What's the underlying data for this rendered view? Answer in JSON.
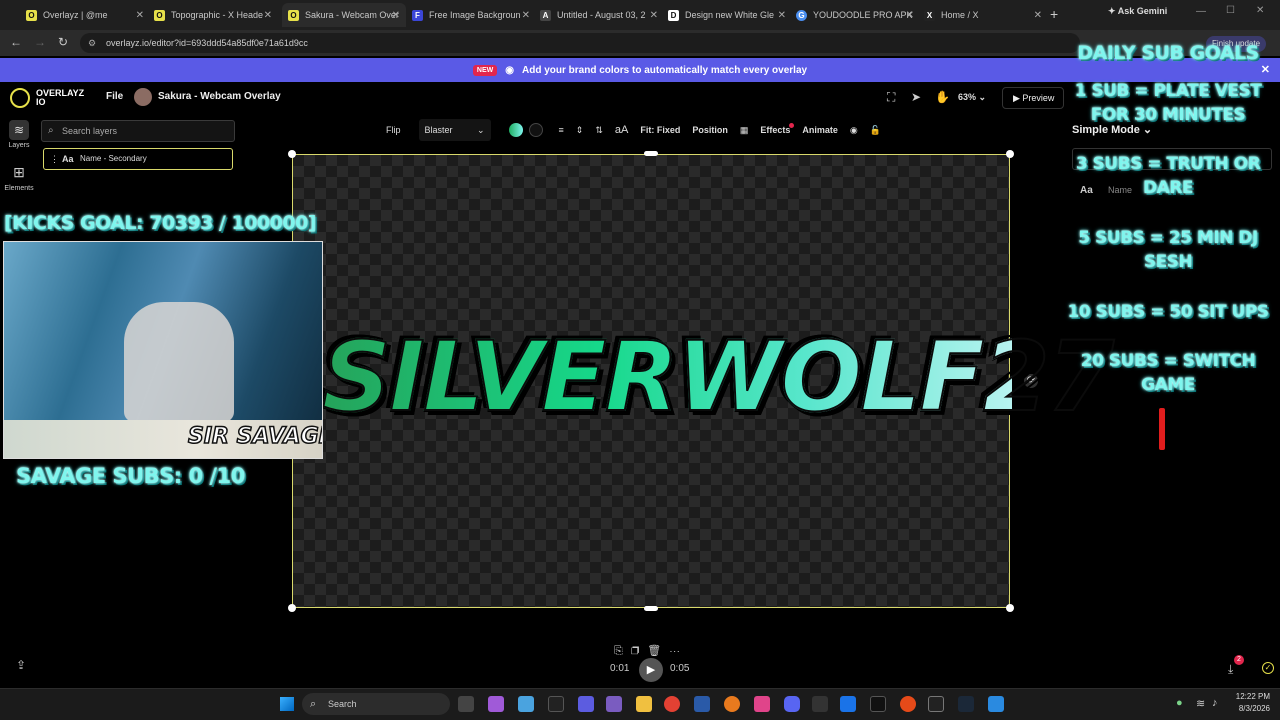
{
  "browser": {
    "tabs": [
      {
        "label": "Overlayz | @me",
        "color": "#e6e04a"
      },
      {
        "label": "Topographic - X Heade",
        "color": "#e6e04a"
      },
      {
        "label": "Sakura - Webcam Over",
        "color": "#e6e04a",
        "active": true
      },
      {
        "label": "Free Image Backgroun",
        "color": "#3b46d8"
      },
      {
        "label": "Untitled - August 03, 2",
        "color": "#2a2a2a"
      },
      {
        "label": "Design new White Gle",
        "color": "#ffffff"
      },
      {
        "label": "YOUDOODLE PRO APK",
        "color": "#4a8ef0"
      },
      {
        "label": "Home / X",
        "color": "#222222"
      }
    ],
    "url": "overlayz.io/editor?id=693ddd54a85df0e71a61d9cc",
    "ask_gemini": "Ask Gemini",
    "finish_update": "Finish update"
  },
  "banner": {
    "badge": "NEW",
    "text": "Add your brand colors to automatically match every overlay"
  },
  "app": {
    "logo_text": "OVERLAYZ IO",
    "file_menu": "File",
    "project_title": "Sakura - Webcam Overlay",
    "zoom": "63%",
    "preview_label": "Preview"
  },
  "rail": {
    "layers": "Layers",
    "elements": "Elements"
  },
  "layers_panel": {
    "search_placeholder": "Search layers",
    "selected_layer": "Name - Secondary"
  },
  "toolbar": {
    "flip": "Flip",
    "font": "Blaster",
    "fit": "Fit: Fixed",
    "position": "Position",
    "effects": "Effects",
    "animate": "Animate",
    "text_size_icon": "aA"
  },
  "canvas": {
    "title_text": "SILVERWOLF27"
  },
  "overlay": {
    "kicks_goal": "[KICKS GOAL: 70393 / 100000]",
    "webcam_name": "SIR SAVAGE",
    "savage_subs": "SAVAGE SUBS: 0 /10",
    "daily_title": "DAILY SUB GOALS",
    "goals": [
      "1 SUB = PLATE VEST FOR 30 MINUTES",
      "3 SUBS = TRUTH OR DARE",
      "5 SUBS = 25 MIN DJ SESH",
      "10 SUBS = 50 SIT UPS",
      "20 SUBS = SWITCH GAME"
    ]
  },
  "right_panel": {
    "mode": "Simple Mode",
    "name_label": "Name"
  },
  "playback": {
    "current": "0:01",
    "total": "0:05"
  },
  "taskbar": {
    "search": "Search",
    "time": "12:22 PM",
    "date": "8/3/2026",
    "download_count": "2"
  }
}
